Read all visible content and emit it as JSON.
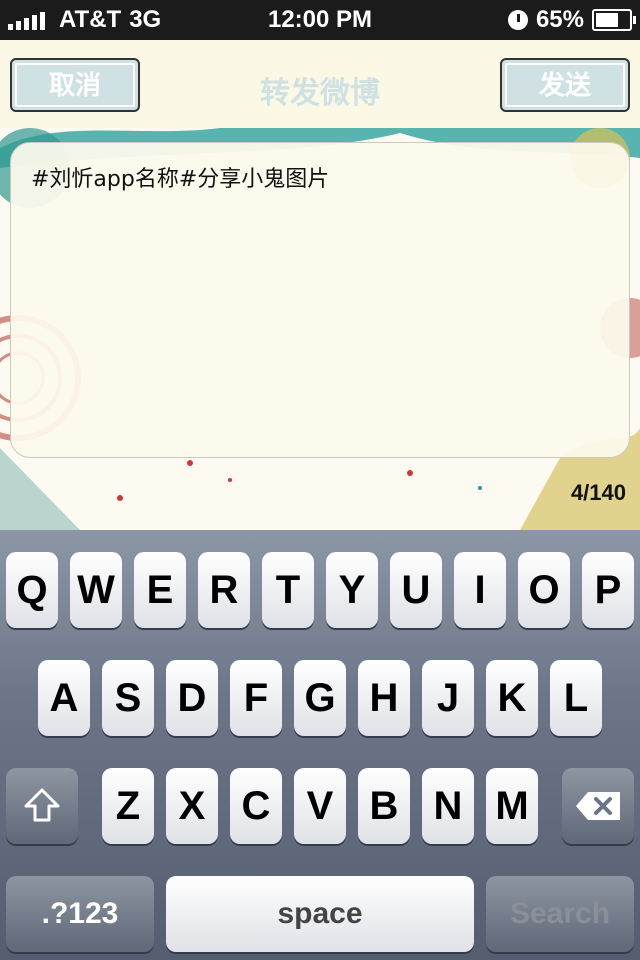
{
  "status_bar": {
    "carrier": "AT&T",
    "network": "3G",
    "time": "12:00 PM",
    "battery": "65%"
  },
  "nav": {
    "cancel": "取消",
    "title": "转发微博",
    "send": "发送"
  },
  "compose": {
    "text": "#刘忻app名称#分享小鬼图片",
    "counter": "4/140"
  },
  "keyboard": {
    "row1": [
      "Q",
      "W",
      "E",
      "R",
      "T",
      "Y",
      "U",
      "I",
      "O",
      "P"
    ],
    "row2": [
      "A",
      "S",
      "D",
      "F",
      "G",
      "H",
      "J",
      "K",
      "L"
    ],
    "row3": [
      "Z",
      "X",
      "C",
      "V",
      "B",
      "N",
      "M"
    ],
    "numbers": ".?123",
    "space": "space",
    "search": "Search"
  }
}
